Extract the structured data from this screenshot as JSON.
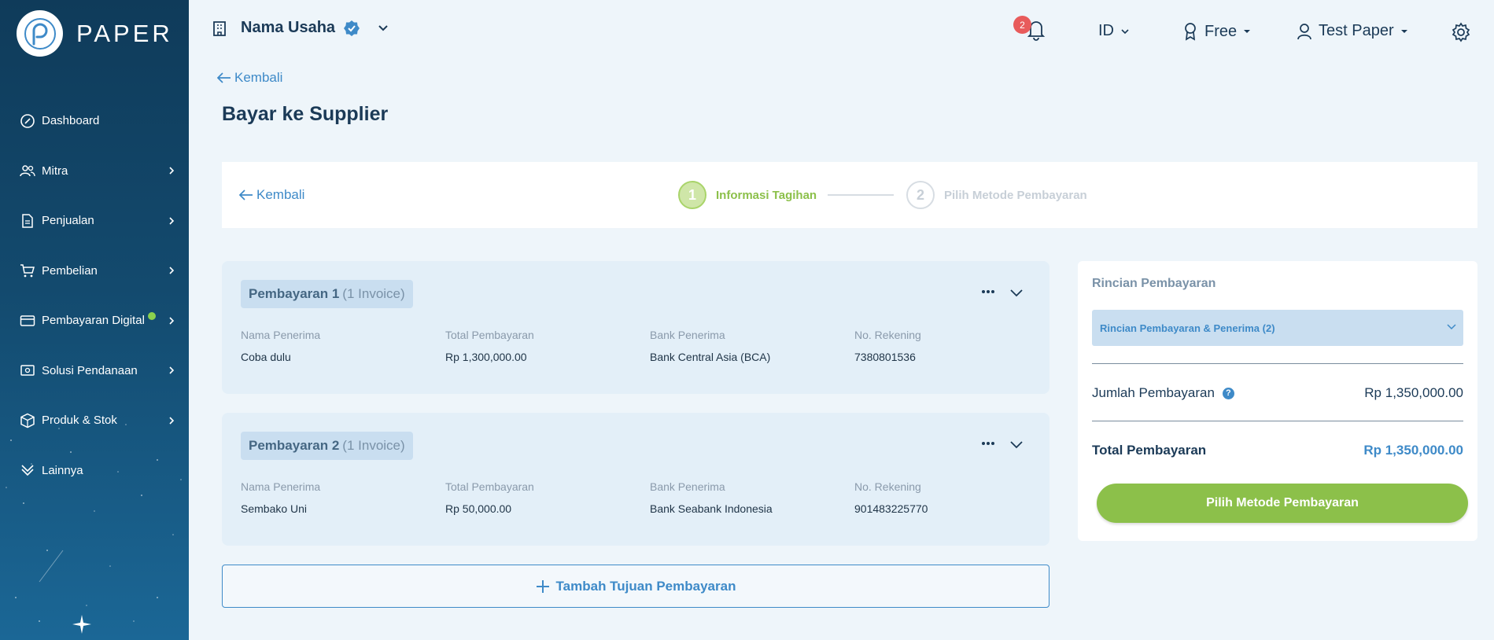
{
  "colors": {
    "sidebar_top": "#0f3b5a",
    "sidebar_bottom": "#1b6796",
    "accent_blue": "#3e8ac8",
    "accent_green": "#8cc04a",
    "badge_red": "#e85b5b"
  },
  "sidebar": {
    "logo_text": "PAPER",
    "items": [
      {
        "label": "Dashboard",
        "icon": "dashboard-icon",
        "has_submenu": false
      },
      {
        "label": "Mitra",
        "icon": "people-icon",
        "has_submenu": true
      },
      {
        "label": "Penjualan",
        "icon": "document-icon",
        "has_submenu": true
      },
      {
        "label": "Pembelian",
        "icon": "cart-icon",
        "has_submenu": true
      },
      {
        "label": "Pembayaran Digital",
        "icon": "card-icon",
        "has_submenu": true,
        "new_dot": true
      },
      {
        "label": "Solusi Pendanaan",
        "icon": "money-icon",
        "has_submenu": true
      },
      {
        "label": "Produk & Stok",
        "icon": "box-icon",
        "has_submenu": true
      },
      {
        "label": "Lainnya",
        "icon": "more-icon",
        "has_submenu": false
      }
    ]
  },
  "header": {
    "business_name": "Nama Usaha",
    "notif_count": "2",
    "language": "ID",
    "plan": "Free",
    "user": "Test Paper"
  },
  "page": {
    "back_label": "Kembali",
    "title": "Bayar ke Supplier"
  },
  "stepper": {
    "back_label": "Kembali",
    "steps": [
      {
        "num": "1",
        "label": "Informasi Tagihan",
        "active": true
      },
      {
        "num": "2",
        "label": "Pilih Metode Pembayaran",
        "active": false
      }
    ]
  },
  "payments": [
    {
      "title": "Pembayaran 1",
      "invoices": "(1 Invoice)",
      "labels": {
        "name": "Nama Penerima",
        "total": "Total Pembayaran",
        "bank": "Bank Penerima",
        "account": "No. Rekening"
      },
      "name": "Coba dulu",
      "total": "Rp 1,300,000.00",
      "bank": "Bank Central Asia (BCA)",
      "account": "7380801536"
    },
    {
      "title": "Pembayaran 2",
      "invoices": "(1 Invoice)",
      "labels": {
        "name": "Nama Penerima",
        "total": "Total Pembayaran",
        "bank": "Bank Penerima",
        "account": "No. Rekening"
      },
      "name": "Sembako Uni",
      "total": "Rp 50,000.00",
      "bank": "Bank Seabank Indonesia",
      "account": "901483225770"
    }
  ],
  "add_button": "Tambah Tujuan Pembayaran",
  "summary": {
    "title": "Rincian Pembayaran",
    "dropdown": "Rincian Pembayaran & Penerima (2)",
    "amount_label": "Jumlah Pembayaran",
    "amount_value": "Rp 1,350,000.00",
    "total_label": "Total Pembayaran",
    "total_value": "Rp 1,350,000.00",
    "cta": "Pilih Metode Pembayaran"
  }
}
